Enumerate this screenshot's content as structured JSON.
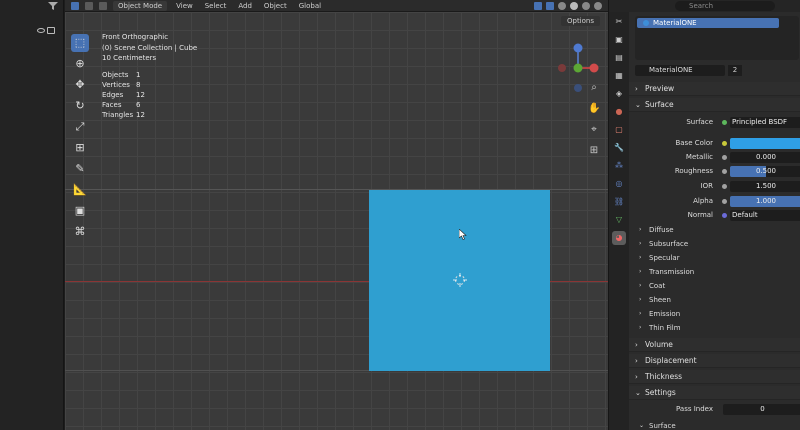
{
  "header": {
    "mode": "Object Mode",
    "menus": [
      "View",
      "Select",
      "Add",
      "Object"
    ],
    "orientation": "Global"
  },
  "viewport": {
    "options_label": "Options",
    "view_name": "Front Orthographic",
    "collection": "(0) Scene Collection | Cube",
    "scale": "10 Centimeters",
    "stats": [
      {
        "label": "Objects",
        "value": "1"
      },
      {
        "label": "Vertices",
        "value": "8"
      },
      {
        "label": "Edges",
        "value": "12"
      },
      {
        "label": "Faces",
        "value": "6"
      },
      {
        "label": "Triangles",
        "value": "12"
      }
    ],
    "cube_color": "#2f9fd0"
  },
  "props": {
    "search_placeholder": "Search",
    "slot_name": "MaterialONE",
    "material_name": "MaterialONE",
    "material_users": "2",
    "sections": {
      "preview": "Preview",
      "surface": "Surface",
      "volume": "Volume",
      "displacement": "Displacement",
      "thickness": "Thickness",
      "settings": "Settings",
      "surface_sub": "Surface"
    },
    "surface_shader": "Principled BSDF",
    "fields": {
      "base_color_label": "Base Color",
      "base_color": "#2f9fe6",
      "metallic_label": "Metallic",
      "metallic": "0.000",
      "roughness_label": "Roughness",
      "roughness": "0.500",
      "ior_label": "IOR",
      "ior": "1.500",
      "alpha_label": "Alpha",
      "alpha": "1.000",
      "normal_label": "Normal",
      "normal": "Default",
      "surface_label": "Surface",
      "pass_index_label": "Pass Index",
      "pass_index": "0"
    },
    "subpanels": [
      "Diffuse",
      "Subsurface",
      "Specular",
      "Transmission",
      "Coat",
      "Sheen",
      "Emission",
      "Thin Film"
    ]
  }
}
